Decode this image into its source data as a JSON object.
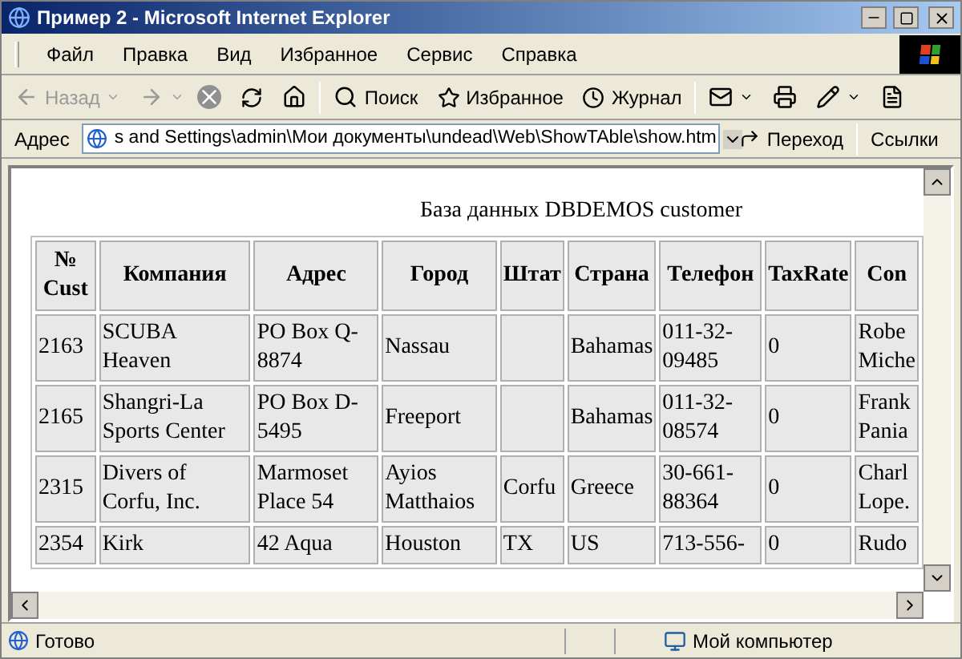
{
  "window": {
    "title": "Пример 2 - Microsoft Internet Explorer"
  },
  "menu": [
    "Файл",
    "Правка",
    "Вид",
    "Избранное",
    "Сервис",
    "Справка"
  ],
  "toolbar": {
    "back": {
      "label": "Назад",
      "disabled": true
    },
    "forward": {
      "disabled": true
    },
    "search": {
      "label": "Поиск"
    },
    "favorites": {
      "label": "Избранное"
    },
    "history": {
      "label": "Журнал"
    }
  },
  "address": {
    "label": "Адрес",
    "value": "s and Settings\\admin\\Мои документы\\undead\\Web\\ShowTAble\\show.htm",
    "go_label": "Переход",
    "links_label": "Ссылки"
  },
  "page": {
    "caption": "База данных DBDEMOS customer",
    "table": {
      "columns": [
        "№ Cust",
        "Компания",
        "Адрес",
        "Город",
        "Штат",
        "Страна",
        "Телефон",
        "TaxRate",
        "Con"
      ],
      "rows": [
        [
          "2163",
          "SCUBA Heaven",
          "PO Box Q-8874",
          "Nassau",
          "",
          "Bahamas",
          "011-32-09485",
          "0",
          "Robe Miche"
        ],
        [
          "2165",
          "Shangri-La Sports Center",
          "PO Box D-5495",
          "Freeport",
          "",
          "Bahamas",
          "011-32-08574",
          "0",
          "Frank Pania"
        ],
        [
          "2315",
          "Divers of Corfu, Inc.",
          "Marmoset Place 54",
          "Ayios Matthaios",
          "Corfu",
          "Greece",
          "30-661-88364",
          "0",
          "Charl Lope."
        ],
        [
          "2354",
          "Kirk",
          "42 Aqua",
          "Houston",
          "TX",
          "US",
          "713-556-",
          "0",
          "Rudo"
        ]
      ]
    }
  },
  "status_bar": {
    "text": "Готово",
    "zone": "Мой компьютер"
  }
}
